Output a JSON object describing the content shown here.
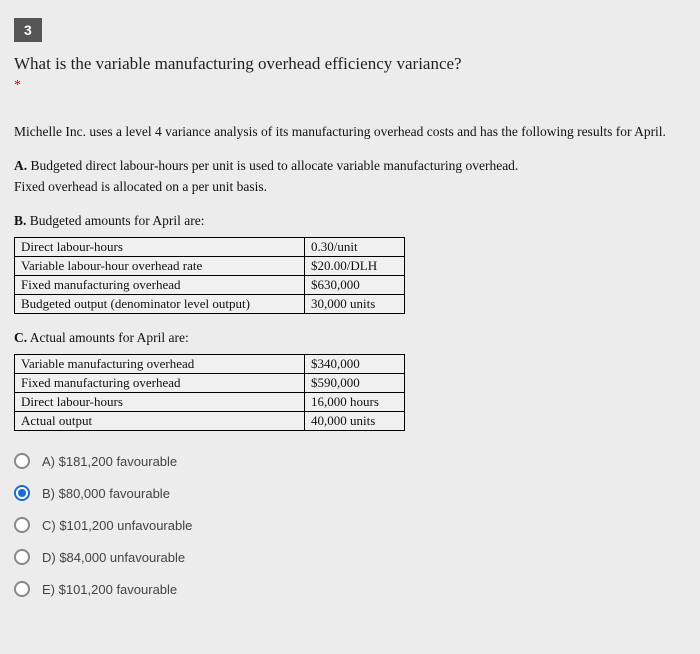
{
  "question": {
    "number": "3",
    "text": "What is the variable manufacturing overhead efficiency variance?",
    "context": "Michelle Inc. uses a level 4 variance analysis of its manufacturing overhead costs and has the following results for April.",
    "pointA_label": "A.",
    "pointA_text1": "Budgeted direct labour-hours per unit is used to allocate variable manufacturing overhead.",
    "pointA_text2": "Fixed overhead is allocated on a per unit basis.",
    "pointB_label": "B.",
    "pointB_text": "Budgeted amounts for April are:",
    "tableB": {
      "rows": [
        {
          "label": "Direct labour-hours",
          "value": "0.30/unit"
        },
        {
          "label": "Variable labour-hour overhead rate",
          "value": "$20.00/DLH"
        },
        {
          "label": "Fixed manufacturing overhead",
          "value": "$630,000"
        },
        {
          "label": "Budgeted output (denominator level output)",
          "value": "30,000 units"
        }
      ]
    },
    "pointC_label": "C.",
    "pointC_text": "Actual amounts for April are:",
    "tableC": {
      "rows": [
        {
          "label": "Variable manufacturing overhead",
          "value": "$340,000"
        },
        {
          "label": "Fixed manufacturing overhead",
          "value": "$590,000"
        },
        {
          "label": "Direct labour-hours",
          "value": "16,000 hours"
        },
        {
          "label": "Actual output",
          "value": "40,000 units"
        }
      ]
    },
    "options": [
      {
        "id": "A",
        "text": "A) $181,200 favourable",
        "selected": false
      },
      {
        "id": "B",
        "text": "B) $80,000 favourable",
        "selected": true
      },
      {
        "id": "C",
        "text": "C) $101,200 unfavourable",
        "selected": false
      },
      {
        "id": "D",
        "text": "D) $84,000 unfavourable",
        "selected": false
      },
      {
        "id": "E",
        "text": "E) $101,200 favourable",
        "selected": false
      }
    ]
  }
}
